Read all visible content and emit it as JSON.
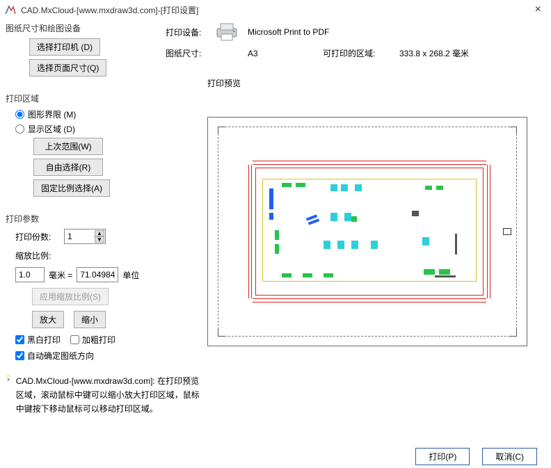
{
  "window": {
    "title": "CAD.MxCloud-[www.mxdraw3d.com]-[打印设置]"
  },
  "group_paper": {
    "title": "图纸尺寸和绘图设备",
    "btn_printer": "选择打印机 (D)",
    "btn_pagesize": "选择页面尺寸(Q)",
    "lbl_device": "打印设备:",
    "device": "Microsoft Print to PDF",
    "lbl_size": "图纸尺寸:",
    "size": "A3",
    "lbl_area": "可打印的区域:",
    "area": "333.8 x 268.2 毫米"
  },
  "group_area": {
    "title": "打印区域",
    "radio_limits": "图形界限 (M)",
    "radio_display": "显示区域 (D)",
    "btn_last": "上次范围(W)",
    "btn_free": "自由选择(R)",
    "btn_fixed": "固定比例选择(A)"
  },
  "group_params": {
    "title": "打印参数",
    "lbl_copies": "打印份数:",
    "copies": "1",
    "lbl_scale": "缩放比例:",
    "mm_val": "1.0",
    "mm_unit": "毫米 =",
    "unit_val": "71.04984",
    "unit_lbl": "单位",
    "btn_apply": "应用缩放比例(S)",
    "btn_zoomin": "放大",
    "btn_zoomout": "缩小",
    "chk_bw": "黑白打印",
    "chk_bold": "加粗打印",
    "chk_auto": "自动确定图纸方向"
  },
  "tip": {
    "title": "CAD.MxCloud-[www.mxdraw3d.com]:",
    "body": "在打印预览区域，滚动鼠标中键可以缩小放大打印区域，鼠标中键按下移动鼠标可以移动打印区域。"
  },
  "preview": {
    "title": "打印预览"
  },
  "footer": {
    "ok": "打印(P)",
    "cancel": "取消(C)"
  }
}
